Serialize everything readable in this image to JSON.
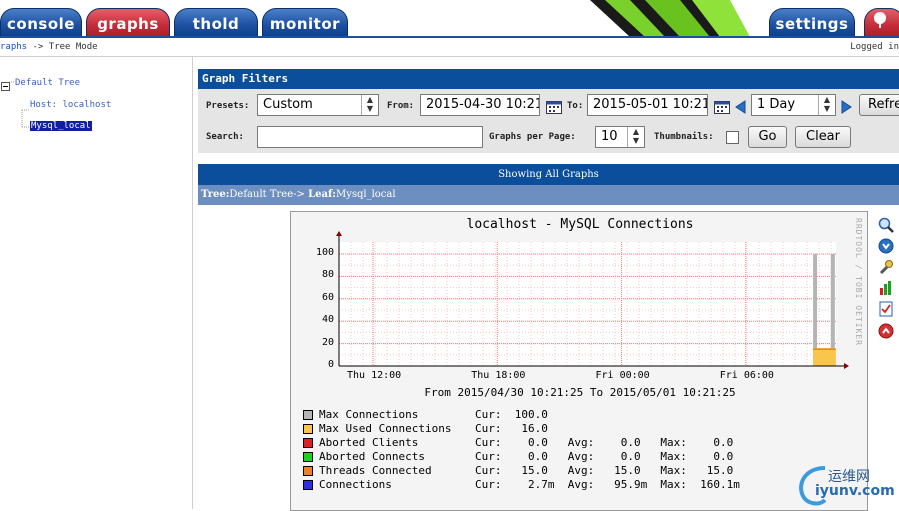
{
  "tabs": [
    {
      "label": "console",
      "style": "blue"
    },
    {
      "label": "graphs",
      "style": "red"
    },
    {
      "label": "thold",
      "style": "blue"
    },
    {
      "label": "monitor",
      "style": "blue"
    },
    {
      "label": "settings",
      "style": "blue"
    }
  ],
  "breadcrumb": {
    "link": "raphs",
    "separator": " -> ",
    "current": "Tree Mode"
  },
  "logged_in": "Logged in",
  "tree": {
    "root": "Default Tree",
    "host": "Host: localhost",
    "leaf": "Mysql_local"
  },
  "filters": {
    "title": "Graph Filters",
    "presets_label": "Presets:",
    "presets_value": "Custom",
    "from_label": "From:",
    "from_value": "2015-04-30 10:21",
    "to_label": "To:",
    "to_value": "2015-05-01 10:21",
    "span_value": "1 Day",
    "refresh_label": "Refresh",
    "search_label": "Search:",
    "search_value": "",
    "per_page_label": "Graphs per Page:",
    "per_page_value": "10",
    "thumbnails_label": "Thumbnails:",
    "go_label": "Go",
    "clear_label": "Clear"
  },
  "showing": "Showing All Graphs",
  "treepath": {
    "tree_label": "Tree:",
    "tree_value": "Default Tree-> ",
    "leaf_label": "Leaf:",
    "leaf_value": "Mysql_local"
  },
  "graph": {
    "side_text": "RRDTOOL / TOBI OETIKER",
    "from_to": "From 2015/04/30 10:21:25 To 2015/05/01 10:21:25",
    "legend": [
      {
        "name": "Max Connections    ",
        "stats": "Cur:  100.0",
        "color": "#b4b4b4"
      },
      {
        "name": "Max Used Connections",
        "stats": "Cur:   16.0",
        "color": "#f9c54a"
      },
      {
        "name": "Aborted Clients    ",
        "stats": "Cur:    0.0   Avg:    0.0   Max:    0.0",
        "color": "#e02020"
      },
      {
        "name": "Aborted Connects   ",
        "stats": "Cur:    0.0   Avg:    0.0   Max:    0.0",
        "color": "#20d020"
      },
      {
        "name": "Threads Connected  ",
        "stats": "Cur:   15.0   Avg:   15.0   Max:   15.0",
        "color": "#f08020"
      },
      {
        "name": "Connections        ",
        "stats": "Cur:    2.7m  Avg:   95.9m  Max:  160.1m",
        "color": "#3030e0"
      }
    ]
  },
  "chart_data": {
    "type": "area",
    "title": "localhost - MySQL Connections",
    "x_tick_labels": [
      "Thu 12:00",
      "Thu 18:00",
      "Fri 00:00",
      "Fri 06:00"
    ],
    "y_tick_labels": [
      "0",
      "20",
      "40",
      "60",
      "80",
      "100"
    ],
    "ylim": [
      0,
      100
    ],
    "grid": true,
    "series": [
      {
        "name": "Max Connections",
        "color": "#b4b4b4",
        "x": [
          "2015-05-01 09:15",
          "2015-05-01 10:21"
        ],
        "values": [
          100,
          100
        ]
      },
      {
        "name": "Max Used Connections",
        "color": "#f9c54a",
        "x": [
          "2015-05-01 09:15",
          "2015-05-01 10:21"
        ],
        "values": [
          16,
          16
        ]
      },
      {
        "name": "Threads Connected",
        "color": "#f08020",
        "x": [
          "2015-05-01 09:15",
          "2015-05-01 10:21"
        ],
        "values": [
          15,
          15
        ]
      }
    ]
  },
  "watermark": {
    "brand": "运维网",
    "site": "iyunv.com"
  }
}
